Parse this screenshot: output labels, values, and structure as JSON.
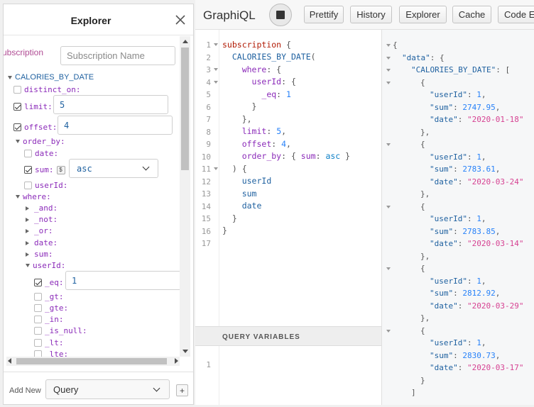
{
  "explorer": {
    "title": "Explorer",
    "operation_keyword": "subscription",
    "operation_name_placeholder": "Subscription Name",
    "root_field": "CALORIES_BY_DATE",
    "args": {
      "distinct_on": "distinct_on:",
      "limit": "limit:",
      "limit_value": "5",
      "offset": "offset:",
      "offset_value": "4",
      "order_by": "order_by:",
      "order_by_date": "date:",
      "order_by_sum": "sum:",
      "order_by_sum_badge": "$",
      "order_by_sum_value": "asc",
      "order_by_userId": "userId:",
      "where": "where:",
      "where_and": "_and:",
      "where_not": "_not:",
      "where_or": "_or:",
      "where_date": "date:",
      "where_sum": "sum:",
      "where_userId": "userId:",
      "eq": "_eq:",
      "eq_value": "1",
      "gt": "_gt:",
      "gte": "_gte:",
      "in": "_in:",
      "is_null": "_is_null:",
      "lt": "_lt:",
      "lte": "_lte:"
    },
    "footer": {
      "add_new_label": "Add New",
      "add_new_value": "Query",
      "plus": "+"
    }
  },
  "toolbar": {
    "title": "GraphiQL",
    "prettify": "Prettify",
    "history": "History",
    "explorer": "Explorer",
    "cache": "Cache",
    "code_exporter": "Code Exporter"
  },
  "query": {
    "line_numbers": [
      "1",
      "2",
      "3",
      "4",
      "5",
      "6",
      "7",
      "8",
      "9",
      "10",
      "11",
      "12",
      "13",
      "14",
      "15",
      "16",
      "17"
    ]
  },
  "variables": {
    "title": "QUERY VARIABLES",
    "line_number": "1"
  },
  "result": {
    "data_key": "\"data\"",
    "root_key": "\"CALORIES_BY_DATE\"",
    "rows": [
      {
        "userId": "1",
        "sum": "2747.95",
        "date": "\"2020-01-18\""
      },
      {
        "userId": "1",
        "sum": "2783.61",
        "date": "\"2020-03-24\""
      },
      {
        "userId": "1",
        "sum": "2783.85",
        "date": "\"2020-03-14\""
      },
      {
        "userId": "1",
        "sum": "2812.92",
        "date": "\"2020-03-29\""
      },
      {
        "userId": "1",
        "sum": "2830.73",
        "date": "\"2020-03-17\""
      }
    ]
  }
}
